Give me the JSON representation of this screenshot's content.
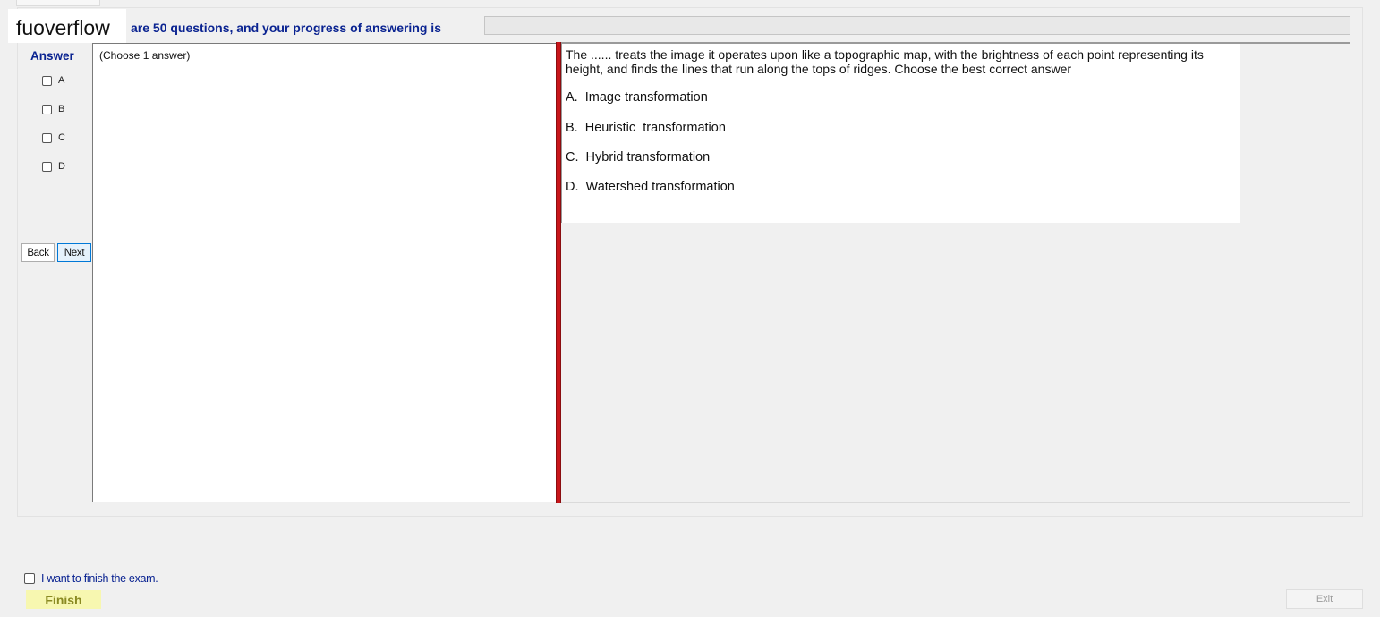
{
  "watermark": "fuoverflow",
  "header": {
    "progress_text": "are 50 questions, and your progress of answering is",
    "progress_fraction": 0
  },
  "answer_panel": {
    "label": "Answer",
    "choices": [
      "A",
      "B",
      "C",
      "D"
    ],
    "back_label": "Back",
    "next_label": "Next",
    "hint": "(Choose 1 answer)"
  },
  "question": {
    "text": "The ...... treats the image it operates upon like a topographic map, with the brightness of each point representing its height, and finds the lines that run along the tops of ridges. Choose the best correct answer",
    "options": [
      "A.  Image transformation",
      "B.  Heuristic  transformation",
      "C.  Hybrid transformation",
      "D.  Watershed transformation"
    ]
  },
  "footer": {
    "finish_checkbox_label": "I want to finish the exam.",
    "finish_label": "Finish",
    "exit_label": "Exit"
  },
  "colors": {
    "accent_text": "#0a2391",
    "splitter": "#c8161a",
    "finish_bg": "#f7f7b0"
  }
}
